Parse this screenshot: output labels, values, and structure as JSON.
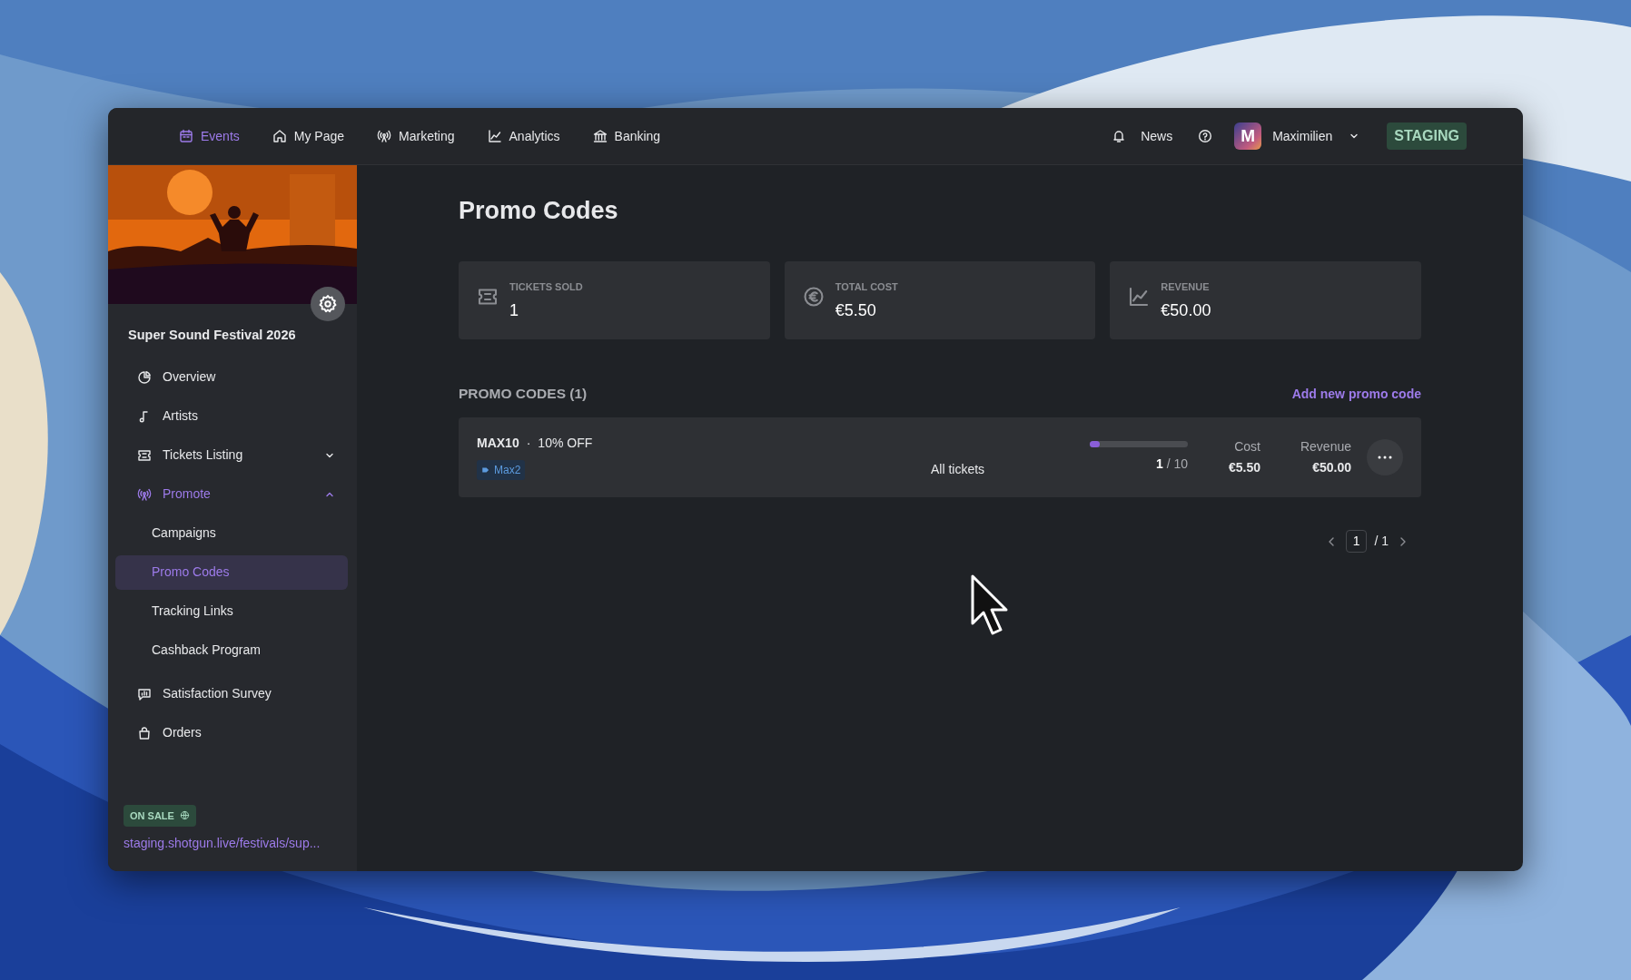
{
  "nav": {
    "items": [
      {
        "label": "Events",
        "selected": true
      },
      {
        "label": "My Page",
        "selected": false
      },
      {
        "label": "Marketing",
        "selected": false
      },
      {
        "label": "Analytics",
        "selected": false
      },
      {
        "label": "Banking",
        "selected": false
      }
    ],
    "news": "News",
    "user": {
      "initial": "M",
      "name": "Maximilien"
    },
    "env_badge": "STAGING"
  },
  "sidebar": {
    "event_name": "Super Sound Festival 2026",
    "items": [
      {
        "label": "Overview",
        "selected": false
      },
      {
        "label": "Artists",
        "selected": false
      },
      {
        "label": "Tickets Listing",
        "selected": false,
        "expanded": false
      },
      {
        "label": "Promote",
        "selected": false,
        "expanded": true,
        "children": [
          {
            "label": "Campaigns",
            "selected": false
          },
          {
            "label": "Promo Codes",
            "selected": true
          },
          {
            "label": "Tracking Links",
            "selected": false
          },
          {
            "label": "Cashback Program",
            "selected": false
          }
        ]
      },
      {
        "label": "Satisfaction Survey",
        "selected": false
      },
      {
        "label": "Orders",
        "selected": false
      }
    ],
    "status": "ON SALE",
    "url": "staging.shotgun.live/festivals/sup..."
  },
  "page": {
    "title": "Promo Codes",
    "stats": [
      {
        "label": "TICKETS SOLD",
        "value": "1"
      },
      {
        "label": "TOTAL COST",
        "value": "€5.50"
      },
      {
        "label": "REVENUE",
        "value": "€50.00"
      }
    ],
    "section_title": "PROMO CODES (1)",
    "add_link": "Add new promo code",
    "promo_codes": [
      {
        "code": "MAX10",
        "separator": "·",
        "discount": "10% OFF",
        "tag": "Max2",
        "scope": "All tickets",
        "level": 0.1,
        "usage": "**1** / 10",
        "cost_label": "Cost",
        "cost": "€5.50",
        "revenue_label": "Revenue",
        "revenue": "€50.00"
      }
    ],
    "pagination": {
      "page": "1",
      "total": "/ 1"
    }
  }
}
